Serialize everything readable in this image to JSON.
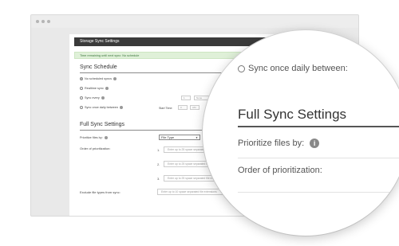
{
  "panel": {
    "title": "Storage Sync Settings"
  },
  "notice": {
    "text": "Time remaining until next sync: No schedule"
  },
  "sync_schedule": {
    "title": "Sync Schedule",
    "options": [
      {
        "label": "No scheduled syncs",
        "selected": true
      },
      {
        "label": "Realtime sync",
        "selected": false
      },
      {
        "label": "Sync every",
        "selected": false
      },
      {
        "label": "Sync once daily between",
        "selected": false
      }
    ],
    "every_value": "1",
    "every_unit": "None",
    "start_time_label": "Start Time:",
    "start_hour": "0",
    "start_ampm": "AM"
  },
  "full_sync": {
    "title": "Full Sync Settings",
    "prioritize_label": "Prioritize files by:",
    "prioritize_value": "File Type",
    "order_label": "Order of prioritization:",
    "order_fields": [
      {
        "num": "1.",
        "placeholder": "Enter up to 25 space separated file extensions"
      },
      {
        "num": "2.",
        "placeholder": "Enter up to 25 space separated file extensions"
      },
      {
        "num": "3.",
        "placeholder": "Enter up to 25 space separated file extensions"
      }
    ],
    "exclude_label": "Exclude file types from sync:",
    "exclude_placeholder": "Enter up to 10 space separated file extensions"
  },
  "magnified": {
    "top_option": "Sync once daily between:",
    "title": "Full Sync Settings",
    "prioritize_label": "Prioritize files by:",
    "info_glyph": "i",
    "order_label": "Order of prioritization:"
  }
}
